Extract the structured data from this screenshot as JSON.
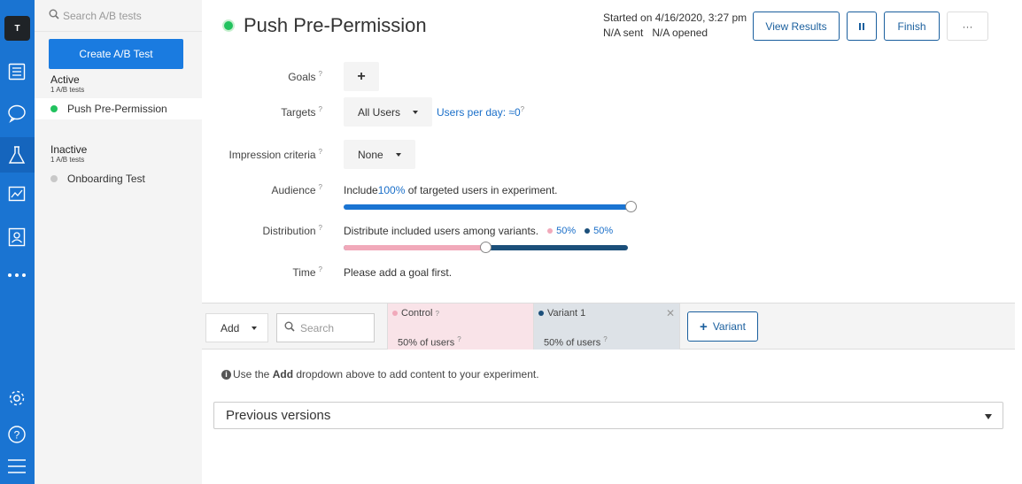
{
  "rail": {
    "avatar_letter": "T",
    "items": [
      "list-icon",
      "chat-icon",
      "flask-icon",
      "chart-icon",
      "contact-icon",
      "more-icon",
      "gear-icon",
      "help-icon",
      "menu-icon"
    ]
  },
  "sidebar": {
    "search_placeholder": "Search A/B tests",
    "create_label": "Create A/B Test",
    "active_title": "Active",
    "active_count": "1 A/B tests",
    "active_item": "Push Pre-Permission",
    "inactive_title": "Inactive",
    "inactive_count": "1 A/B tests",
    "inactive_item": "Onboarding Test"
  },
  "header": {
    "title": "Push Pre-Permission",
    "started": "Started on 4/16/2020, 3:27 pm",
    "sent": "N/A sent",
    "opened": "N/A opened",
    "view_results": "View Results",
    "finish": "Finish",
    "more": "···"
  },
  "form": {
    "goals_label": "Goals",
    "goals_add": "+",
    "targets_label": "Targets",
    "targets_value": "All Users",
    "users_per_day": "Users per day: ≈0",
    "impression_label": "Impression criteria",
    "impression_value": "None",
    "audience_label": "Audience",
    "audience_include": "Include",
    "audience_pct": "100%",
    "audience_rest": "of targeted users in experiment.",
    "audience_fraction": 1.0,
    "distribution_label": "Distribution",
    "distribution_text": "Distribute included users among variants.",
    "dist_control_pct": "50%",
    "dist_variant_pct": "50%",
    "distribution_fraction": 0.5,
    "time_label": "Time",
    "time_text": "Please add a goal first.",
    "help_mark": "?"
  },
  "variants": {
    "add_label": "Add",
    "search_placeholder": "Search",
    "columns": [
      {
        "name": "Control",
        "pct": "50% of users"
      },
      {
        "name": "Variant 1",
        "pct": "50% of users"
      }
    ],
    "add_variant": "Variant"
  },
  "hint": {
    "pre": "Use the",
    "bold": "Add",
    "post": "dropdown above to add content to your experiment."
  },
  "previous_versions": "Previous versions",
  "colors": {
    "brand": "#1a74d2",
    "active_dot": "#21c25e",
    "control": "#f1a9ba",
    "variant": "#1b4f7a"
  }
}
